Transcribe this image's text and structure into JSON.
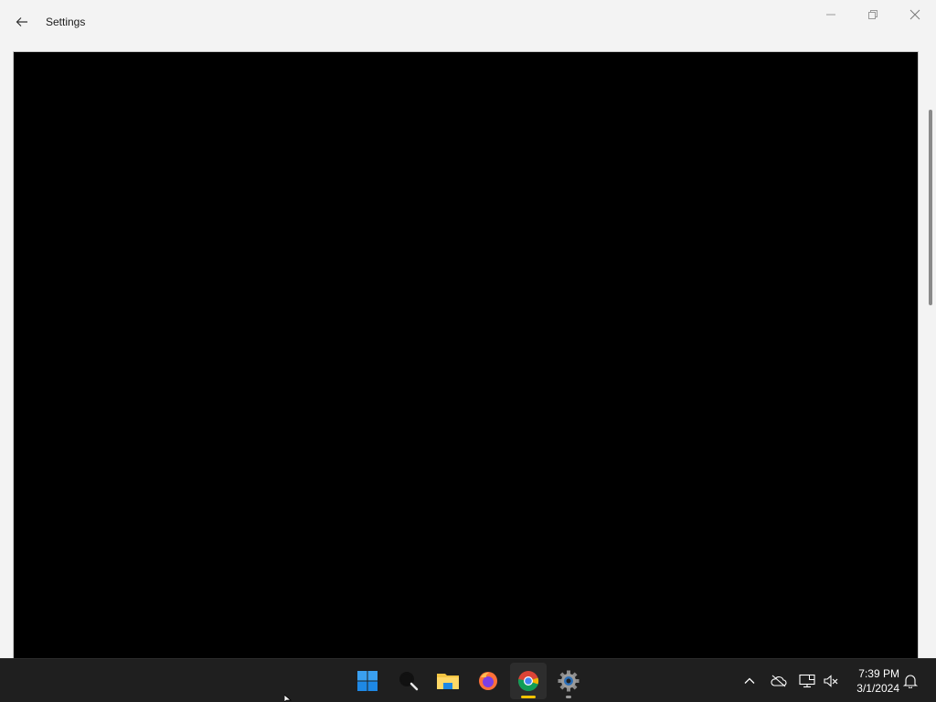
{
  "window": {
    "title": "Settings",
    "back_icon": "arrow-left-icon",
    "controls": {
      "minimize_icon": "minimize-icon",
      "maximize_icon": "restore-icon",
      "close_icon": "close-icon"
    }
  },
  "content": {
    "background_color": "#000000"
  },
  "taskbar": {
    "pinned": [
      {
        "name": "start",
        "icon": "windows-logo-icon",
        "state": "none"
      },
      {
        "name": "search",
        "icon": "search-icon",
        "state": "none"
      },
      {
        "name": "file-explorer",
        "icon": "folder-icon",
        "state": "none"
      },
      {
        "name": "firefox",
        "icon": "firefox-icon",
        "state": "none"
      },
      {
        "name": "chrome",
        "icon": "chrome-icon",
        "state": "open-active"
      },
      {
        "name": "settings",
        "icon": "gear-icon",
        "state": "running"
      }
    ],
    "tray": {
      "overflow_icon": "chevron-up-icon",
      "onedrive_icon": "cloud-off-icon",
      "network_icon": "network-icon",
      "volume_icon": "volume-muted-icon",
      "time": "7:39 PM",
      "date": "3/1/2024",
      "notification_icon": "bell-icon"
    },
    "colors": {
      "background": "#1f1f1f",
      "active_indicator": "#f3c200"
    }
  }
}
